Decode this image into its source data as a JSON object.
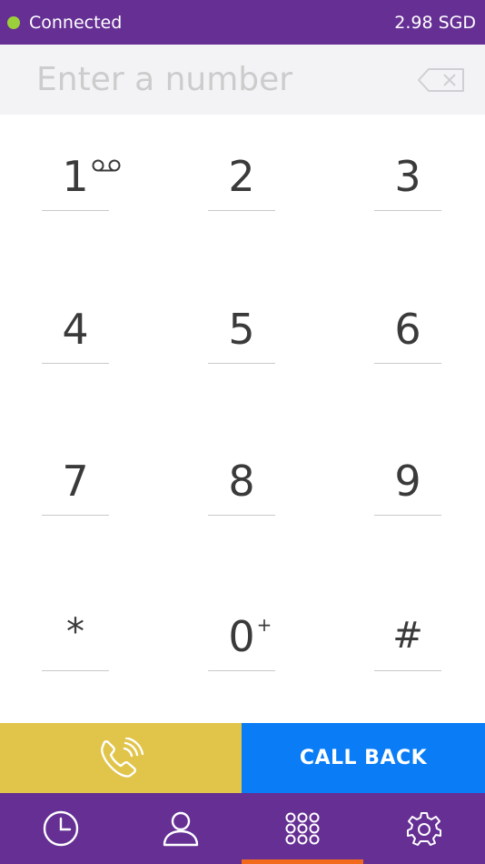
{
  "status": {
    "connection": "Connected",
    "balance": "2.98 SGD",
    "dot_color": "#9bd03a"
  },
  "dialer": {
    "placeholder": "Enter a number",
    "value": ""
  },
  "keys": {
    "k1": "1",
    "k2": "2",
    "k3": "3",
    "k4": "4",
    "k5": "5",
    "k6": "6",
    "k7": "7",
    "k8": "8",
    "k9": "9",
    "star": "*",
    "k0": "0",
    "k0_sup": "+",
    "hash": "#"
  },
  "actions": {
    "call_icon": "phone-call-icon",
    "callback_label": "CALL BACK"
  },
  "tabs": {
    "active": "keypad",
    "items": [
      "history-icon",
      "contacts-icon",
      "keypad-icon",
      "settings-icon"
    ]
  },
  "colors": {
    "brand_purple": "#652f94",
    "call_yellow": "#e1c44a",
    "callback_blue": "#0a7cf5",
    "active_orange": "#f26b1d"
  }
}
